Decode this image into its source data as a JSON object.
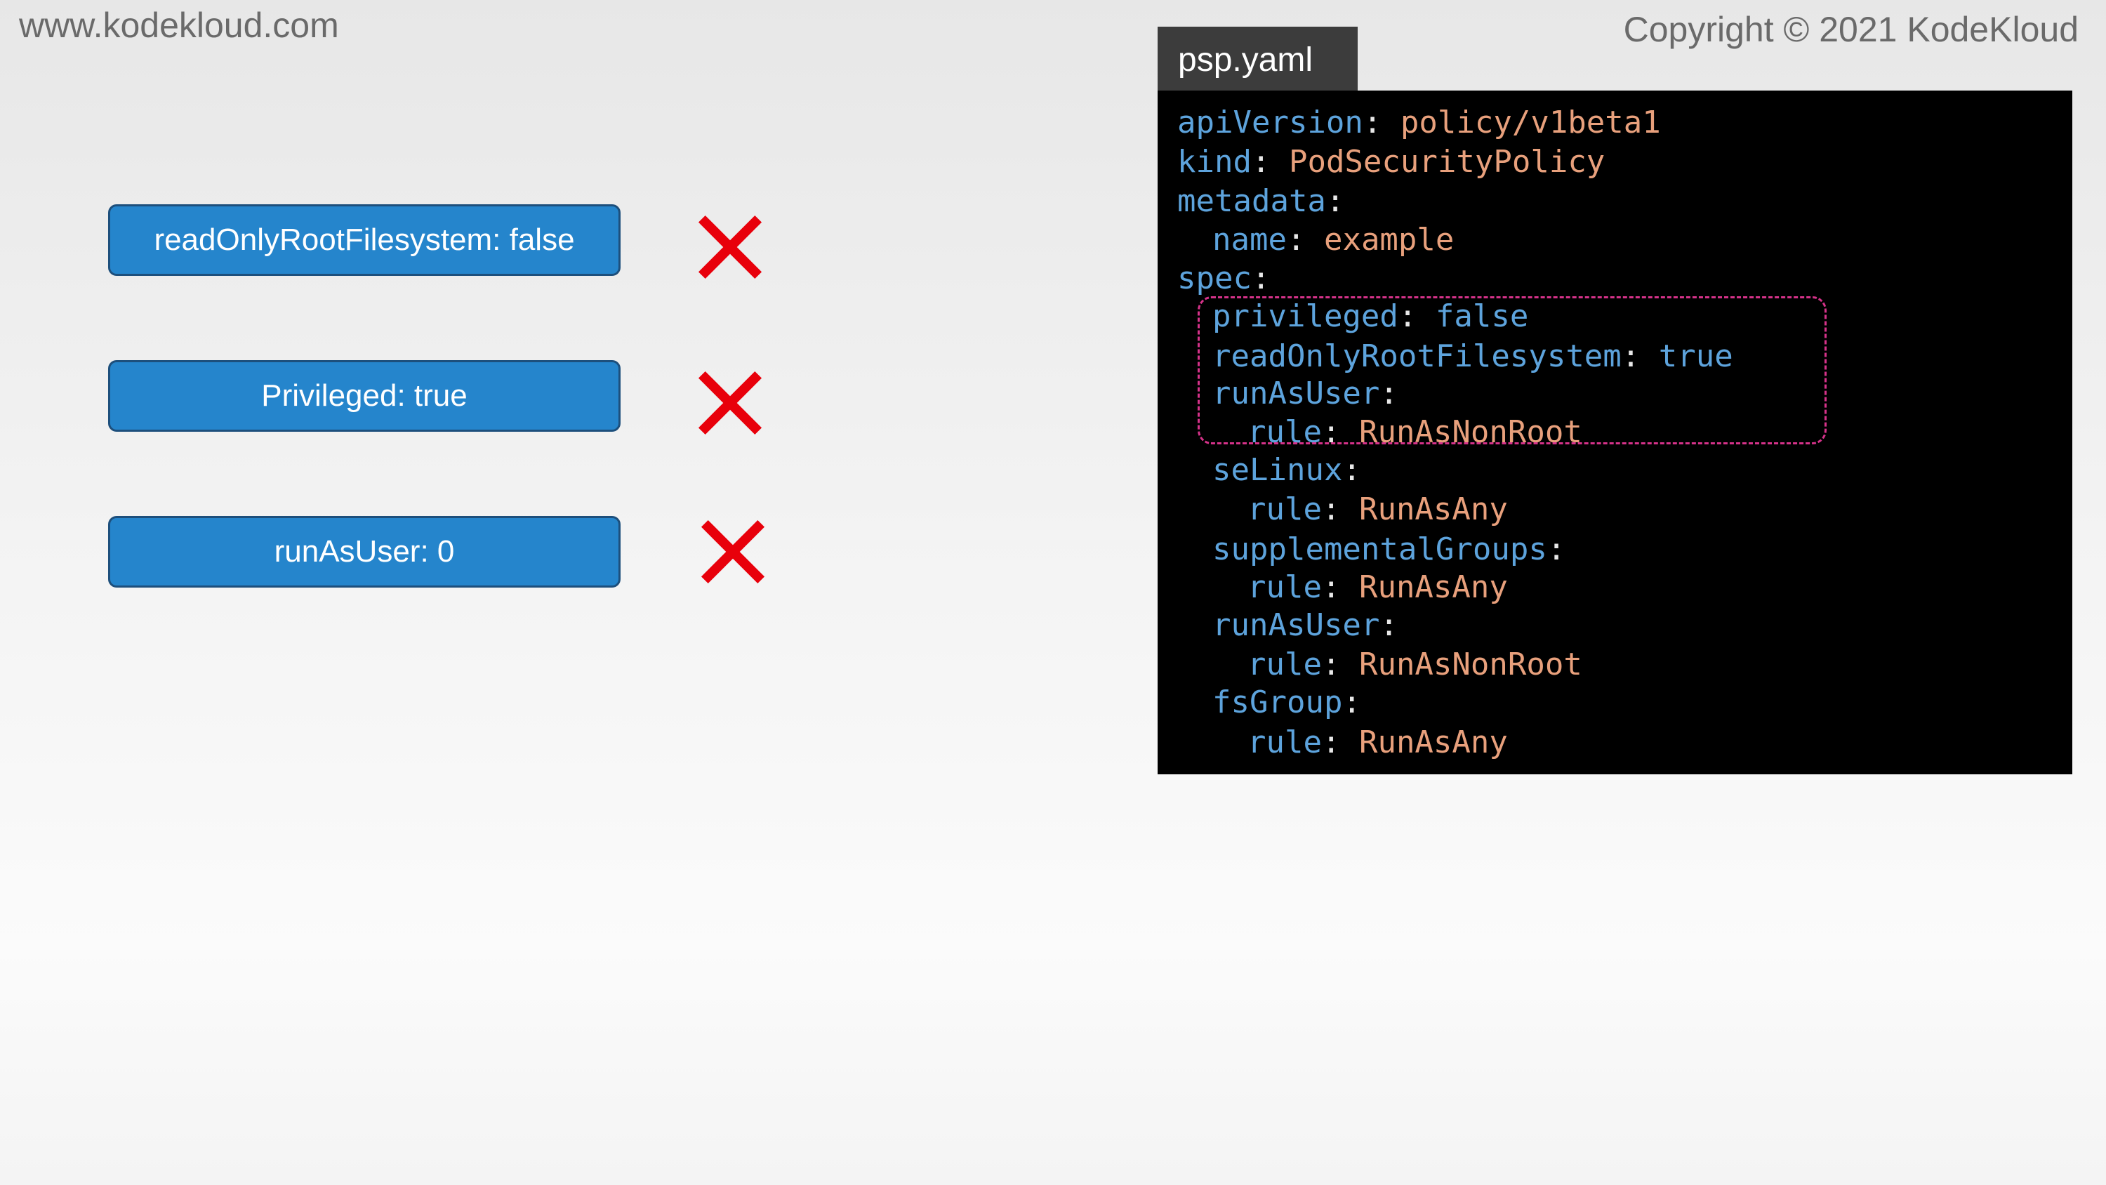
{
  "header": {
    "site_url": "www.kodekloud.com",
    "copyright": "Copyright © 2021 KodeKloud"
  },
  "settings": [
    {
      "label": "readOnlyRootFilesystem: false",
      "status_icon": "red-x-icon"
    },
    {
      "label": "Privileged: true",
      "status_icon": "red-x-icon"
    },
    {
      "label": "runAsUser: 0",
      "status_icon": "red-x-icon"
    }
  ],
  "editor": {
    "file_tab": "psp.yaml",
    "lines": [
      {
        "key": "apiVersion",
        "sep": ":",
        "value": " policy/v1beta1"
      },
      {
        "key": "kind",
        "sep": ":",
        "value": " PodSecurityPolicy"
      },
      {
        "key": "metadata",
        "sep": ":",
        "value": ""
      },
      {
        "key": "name",
        "sep": ":",
        "value": " example"
      },
      {
        "key": "spec",
        "sep": ":",
        "value": ""
      },
      {
        "key": "privileged",
        "sep": ":",
        "value": " false"
      },
      {
        "key": "readOnlyRootFilesystem",
        "sep": ":",
        "value": " true"
      },
      {
        "key": "runAsUser",
        "sep": ":",
        "value": ""
      },
      {
        "key": "rule",
        "sep": ":",
        "value": " RunAsNonRoot"
      },
      {
        "key": "seLinux",
        "sep": ":",
        "value": ""
      },
      {
        "key": "rule",
        "sep": ":",
        "value": " RunAsAny"
      },
      {
        "key": "supplementalGroups",
        "sep": ":",
        "value": ""
      },
      {
        "key": "rule",
        "sep": ":",
        "value": " RunAsAny"
      },
      {
        "key": "runAsUser",
        "sep": ":",
        "value": ""
      },
      {
        "key": "rule",
        "sep": ":",
        "value": " RunAsNonRoot"
      },
      {
        "key": "fsGroup",
        "sep": ":",
        "value": ""
      },
      {
        "key": "rule",
        "sep": ":",
        "value": " RunAsAny"
      }
    ]
  },
  "colors": {
    "setting_box_fill": "#2585cc",
    "x_mark": "#e8000b",
    "yaml_key": "#5da3dc",
    "yaml_value": "#e8a07c",
    "highlight_border": "#d6328a"
  }
}
